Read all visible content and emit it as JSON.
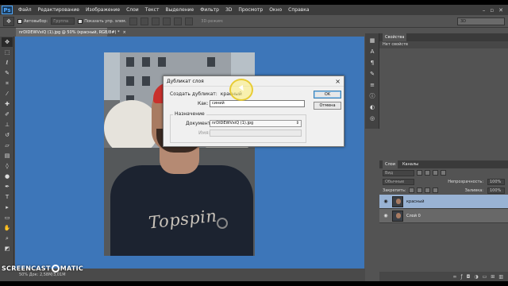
{
  "app": {
    "logo": "Ps",
    "menu": [
      "Файл",
      "Редактирование",
      "Изображение",
      "Слои",
      "Текст",
      "Выделение",
      "Фильтр",
      "3D",
      "Просмотр",
      "Окно",
      "Справка"
    ],
    "window_controls": [
      "–",
      "▫",
      "✕"
    ]
  },
  "options": {
    "autoselect_label": "Автовыбор:",
    "group_label": "Группа",
    "show_controls_label": "Показать упр. элем.",
    "mode3d_label": "3D-режим:",
    "workspace_value": "3D"
  },
  "document": {
    "tab_title": "nrDIDEWVxiQ (1).jpg @ 50% (красный, RGB/8#) *",
    "status_text": "50%    Док: 2,58M/3,01M",
    "photo_shirt_text": "Topspin"
  },
  "dialog": {
    "title": "Дубликат слоя",
    "duplicate_label": "Создать дубликат:",
    "duplicate_value": "красный",
    "as_label": "Как:",
    "as_value": "синий",
    "destination_legend": "Назначение",
    "document_label": "Документ:",
    "document_value": "nrDIDEWVxiQ (1).jpg",
    "name_label": "Имя:",
    "name_value": "",
    "ok_label": "OK",
    "cancel_label": "Отмена"
  },
  "panels": {
    "properties_tab": "Свойства",
    "properties_empty": "Нет свойств",
    "layers_tab": "Слои",
    "channels_tab": "Каналы",
    "kind_select": "Вид",
    "blend_mode": "Обычные",
    "opacity_label": "Непрозрачность:",
    "opacity_value": "100%",
    "lock_label": "Закрепить:",
    "fill_label": "Заливка:",
    "fill_value": "100%",
    "layers": [
      {
        "name": "красный",
        "selected": true
      },
      {
        "name": "Слой 0",
        "selected": false
      }
    ]
  },
  "watermark": {
    "left": "SCREENCAST",
    "right": "MATIC"
  },
  "colors": {
    "canvas_bg": "#3d76b9",
    "selected_layer": "#99b3d4",
    "highlight": "#f5e663"
  }
}
